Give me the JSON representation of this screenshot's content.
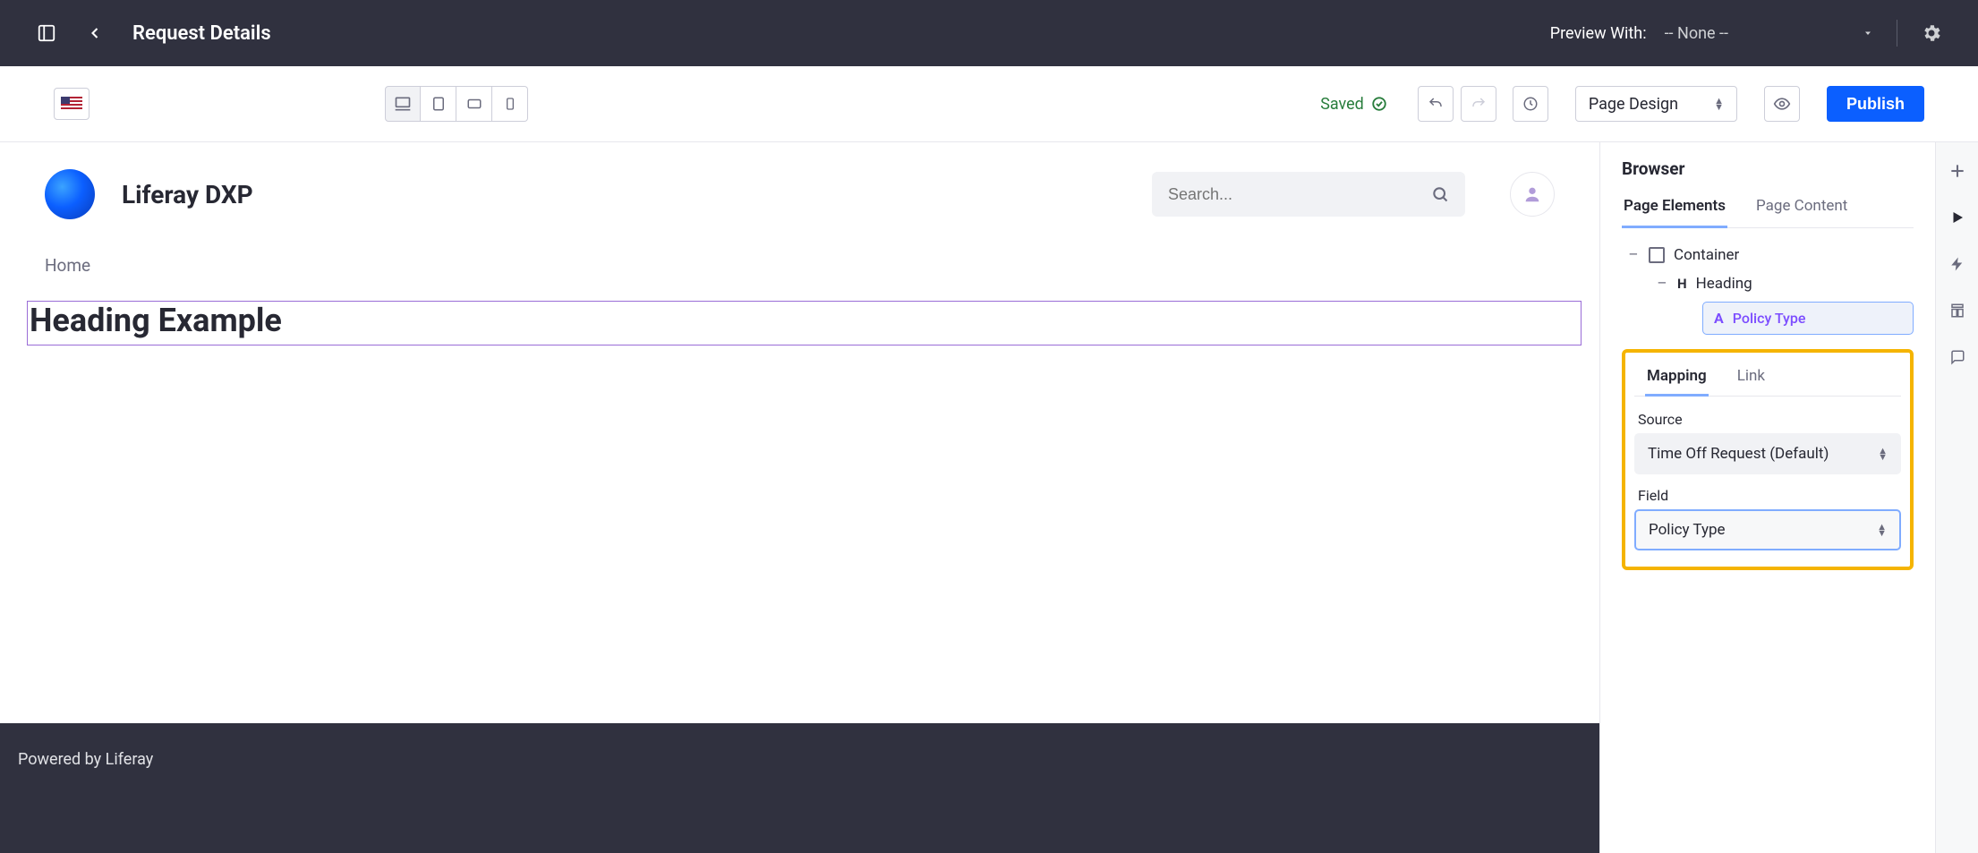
{
  "topbar": {
    "title": "Request Details",
    "preview_label": "Preview With:",
    "preview_value": "-- None --"
  },
  "secondary": {
    "saved_label": "Saved",
    "mode_label": "Page Design",
    "publish_label": "Publish"
  },
  "canvas": {
    "brand": "Liferay DXP",
    "search_placeholder": "Search...",
    "breadcrumb": "Home",
    "heading_text": "Heading Example",
    "footer_text": "Powered by Liferay"
  },
  "browser": {
    "title": "Browser",
    "tabs": {
      "elements": "Page Elements",
      "content": "Page Content"
    },
    "tree": {
      "container": "Container",
      "heading": "Heading",
      "policy_type": "Policy Type"
    },
    "mapping_tabs": {
      "mapping": "Mapping",
      "link": "Link"
    },
    "source_label": "Source",
    "source_value": "Time Off Request (Default)",
    "field_label": "Field",
    "field_value": "Policy Type"
  }
}
